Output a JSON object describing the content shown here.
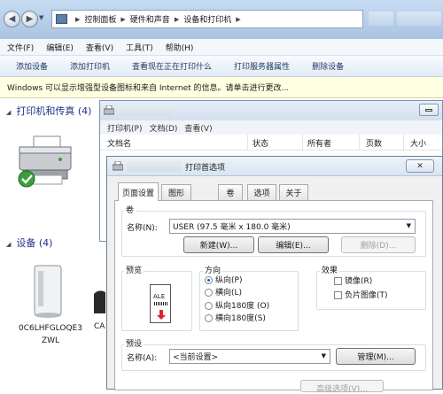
{
  "window": {
    "breadcrumbs": [
      "控制面板",
      "硬件和声音",
      "设备和打印机"
    ],
    "menu": [
      "文件(F)",
      "编辑(E)",
      "查看(V)",
      "工具(T)",
      "帮助(H)"
    ],
    "commands": [
      "添加设备",
      "添加打印机",
      "查看现在正在打印什么",
      "打印服务器属性",
      "删除设备"
    ],
    "info_bar": "Windows 可以显示增强型设备图标和来自 Internet 的信息。请单击进行更改...",
    "section_printers": "打印机和传真 (4)",
    "section_devices": "设备 (4)",
    "device_label": "0C6LHFGLOQE3 ZWL",
    "device_label_2": "CA"
  },
  "queue_window": {
    "menu": [
      "打印机(P)",
      "文档(D)",
      "查看(V)"
    ],
    "columns": [
      "文档名",
      "状态",
      "所有者",
      "页数",
      "大小"
    ]
  },
  "dialog": {
    "title_suffix": "打印首选项",
    "close_label": "✕",
    "tabs": [
      "页面设置",
      "图形",
      "卷",
      "选项",
      "关于"
    ],
    "volume": {
      "label": "卷",
      "name_label": "名称(N):",
      "name_value": "USER (97.5 毫米 x 180.0 毫米)",
      "new_button": "新建(W)...",
      "edit_button": "编辑(E)...",
      "delete_button": "删除(D)..."
    },
    "preview": {
      "label": "预览",
      "paper_text": "ALE"
    },
    "orientation": {
      "label": "方向",
      "options": [
        "纵向(P)",
        "横向(L)",
        "纵向180度 (O)",
        "横向180度(S)"
      ],
      "selected": "纵向(P)"
    },
    "effects": {
      "label": "效果",
      "options": [
        "镜像(R)",
        "负片图像(T)"
      ]
    },
    "preset": {
      "label": "预设",
      "name_label": "名称(A):",
      "name_value": "<当前设置>",
      "manage_button": "管理(M)..."
    },
    "advanced_button": "高级选项(V)..."
  }
}
